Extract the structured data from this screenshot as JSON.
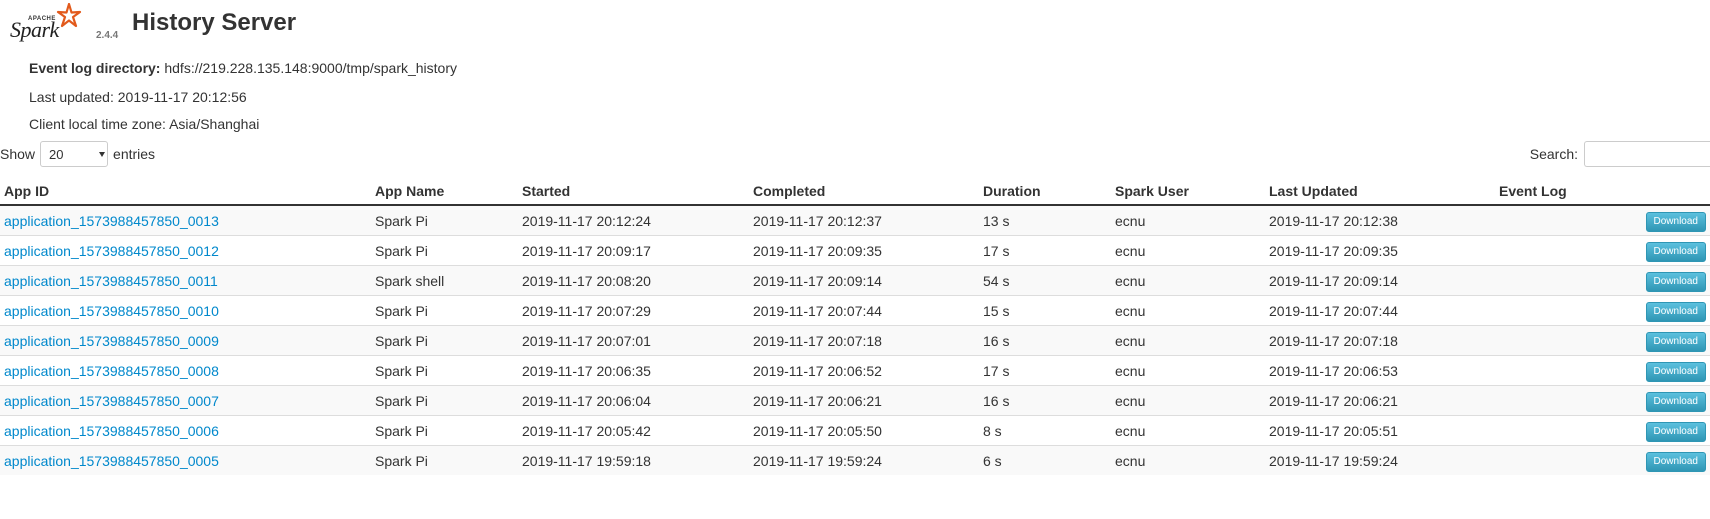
{
  "header": {
    "logo_apache": "APACHE",
    "logo_spark": "Spark",
    "version": "2.4.4",
    "title": "History Server"
  },
  "info": {
    "event_log_label": "Event log directory:",
    "event_log_value": "hdfs://219.228.135.148:9000/tmp/spark_history",
    "last_updated_label": "Last updated:",
    "last_updated_value": "2019-11-17 20:12:56",
    "timezone_label": "Client local time zone:",
    "timezone_value": "Asia/Shanghai"
  },
  "controls": {
    "show_label": "Show",
    "entries_value": "20",
    "entries_label": "entries",
    "search_label": "Search:",
    "search_value": ""
  },
  "table": {
    "columns": [
      "App ID",
      "App Name",
      "Started",
      "Completed",
      "Duration",
      "Spark User",
      "Last Updated",
      "Event Log"
    ],
    "download_label": "Download",
    "rows": [
      {
        "app_id": "application_1573988457850_0013",
        "app_name": "Spark Pi",
        "started": "2019-11-17 20:12:24",
        "completed": "2019-11-17 20:12:37",
        "duration": "13 s",
        "user": "ecnu",
        "last_updated": "2019-11-17 20:12:38"
      },
      {
        "app_id": "application_1573988457850_0012",
        "app_name": "Spark Pi",
        "started": "2019-11-17 20:09:17",
        "completed": "2019-11-17 20:09:35",
        "duration": "17 s",
        "user": "ecnu",
        "last_updated": "2019-11-17 20:09:35"
      },
      {
        "app_id": "application_1573988457850_0011",
        "app_name": "Spark shell",
        "started": "2019-11-17 20:08:20",
        "completed": "2019-11-17 20:09:14",
        "duration": "54 s",
        "user": "ecnu",
        "last_updated": "2019-11-17 20:09:14"
      },
      {
        "app_id": "application_1573988457850_0010",
        "app_name": "Spark Pi",
        "started": "2019-11-17 20:07:29",
        "completed": "2019-11-17 20:07:44",
        "duration": "15 s",
        "user": "ecnu",
        "last_updated": "2019-11-17 20:07:44"
      },
      {
        "app_id": "application_1573988457850_0009",
        "app_name": "Spark Pi",
        "started": "2019-11-17 20:07:01",
        "completed": "2019-11-17 20:07:18",
        "duration": "16 s",
        "user": "ecnu",
        "last_updated": "2019-11-17 20:07:18"
      },
      {
        "app_id": "application_1573988457850_0008",
        "app_name": "Spark Pi",
        "started": "2019-11-17 20:06:35",
        "completed": "2019-11-17 20:06:52",
        "duration": "17 s",
        "user": "ecnu",
        "last_updated": "2019-11-17 20:06:53"
      },
      {
        "app_id": "application_1573988457850_0007",
        "app_name": "Spark Pi",
        "started": "2019-11-17 20:06:04",
        "completed": "2019-11-17 20:06:21",
        "duration": "16 s",
        "user": "ecnu",
        "last_updated": "2019-11-17 20:06:21"
      },
      {
        "app_id": "application_1573988457850_0006",
        "app_name": "Spark Pi",
        "started": "2019-11-17 20:05:42",
        "completed": "2019-11-17 20:05:50",
        "duration": "8 s",
        "user": "ecnu",
        "last_updated": "2019-11-17 20:05:51"
      },
      {
        "app_id": "application_1573988457850_0005",
        "app_name": "Spark Pi",
        "started": "2019-11-17 19:59:18",
        "completed": "2019-11-17 19:59:24",
        "duration": "6 s",
        "user": "ecnu",
        "last_updated": "2019-11-17 19:59:24"
      }
    ]
  },
  "colors": {
    "link": "#0088cc",
    "download_button": "#49afcd",
    "logo_star": "#e25a1c"
  }
}
